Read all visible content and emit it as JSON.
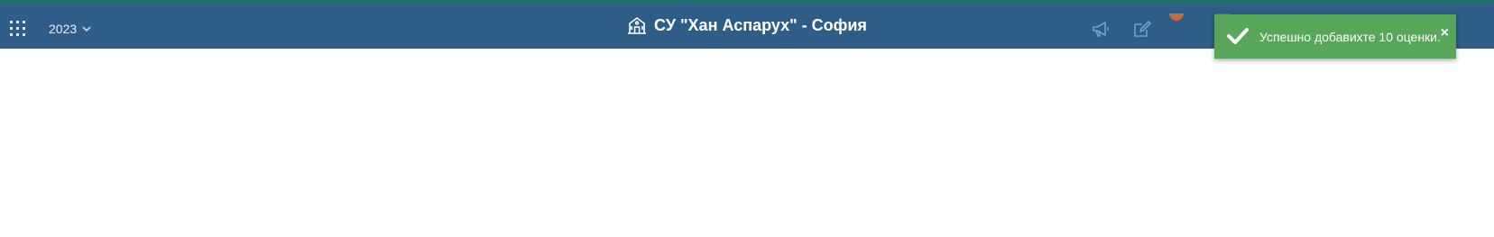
{
  "header": {
    "year_selector": {
      "value": "2023",
      "icon": "chevron-down-icon"
    },
    "apps_icon": "grid-icon",
    "school_icon": "school-building-icon",
    "title": "СУ \"Хан Аспарух\" - София",
    "actions": [
      {
        "name": "announcements",
        "icon": "megaphone-icon"
      },
      {
        "name": "edit",
        "icon": "edit-icon"
      }
    ]
  },
  "toast": {
    "status": "success",
    "icon": "check-icon",
    "message": "Успешно добавихте 10 оценки.",
    "close_label": "×"
  },
  "colors": {
    "header_bg": "#2e5d88",
    "top_line": "#1f6f66",
    "toast_bg": "#58a65a",
    "header_icon": "#6aa2d8"
  }
}
